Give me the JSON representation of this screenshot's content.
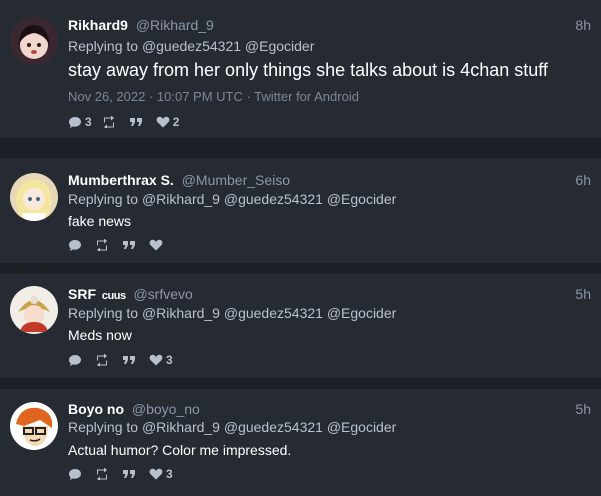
{
  "tweets": [
    {
      "name": "Rikhard9",
      "handle": "@Rikhard_9",
      "time": "8h",
      "replying_prefix": "Replying to",
      "mentions": [
        "@guedez54321",
        "@Egocider"
      ],
      "text": "stay away from her only things she talks about is 4chan stuff",
      "meta": "Nov 26, 2022 · 10:07 PM UTC · Twitter for Android",
      "replies": "3",
      "retweets": "",
      "quotes": "",
      "likes": "2"
    },
    {
      "name": "Mumberthrax S.",
      "handle": "@Mumber_Seiso",
      "time": "6h",
      "replying_prefix": "Replying to",
      "mentions": [
        "@Rikhard_9",
        "@guedez54321",
        "@Egocider"
      ],
      "text": "fake news",
      "replies": "",
      "retweets": "",
      "quotes": "",
      "likes": ""
    },
    {
      "name": "SRF",
      "name_badge": "cuus",
      "handle": "@srfvevo",
      "time": "5h",
      "replying_prefix": "Replying to",
      "mentions": [
        "@Rikhard_9",
        "@guedez54321",
        "@Egocider"
      ],
      "text": "Meds now",
      "replies": "",
      "retweets": "",
      "quotes": "",
      "likes": "3"
    },
    {
      "name": "Boyo no",
      "handle": "@boyo_no",
      "time": "5h",
      "replying_prefix": "Replying to",
      "mentions": [
        "@Rikhard_9",
        "@guedez54321",
        "@Egocider"
      ],
      "text": "Actual humor? Color me impressed.",
      "replies": "",
      "retweets": "",
      "quotes": "",
      "likes": "3"
    }
  ],
  "icons": [
    "comment-icon",
    "retweet-icon",
    "quote-icon",
    "heart-icon"
  ],
  "colors": {
    "background": "#1b1f26",
    "card": "#252a33",
    "name": "#ffffff",
    "muted": "#8b98a8"
  }
}
